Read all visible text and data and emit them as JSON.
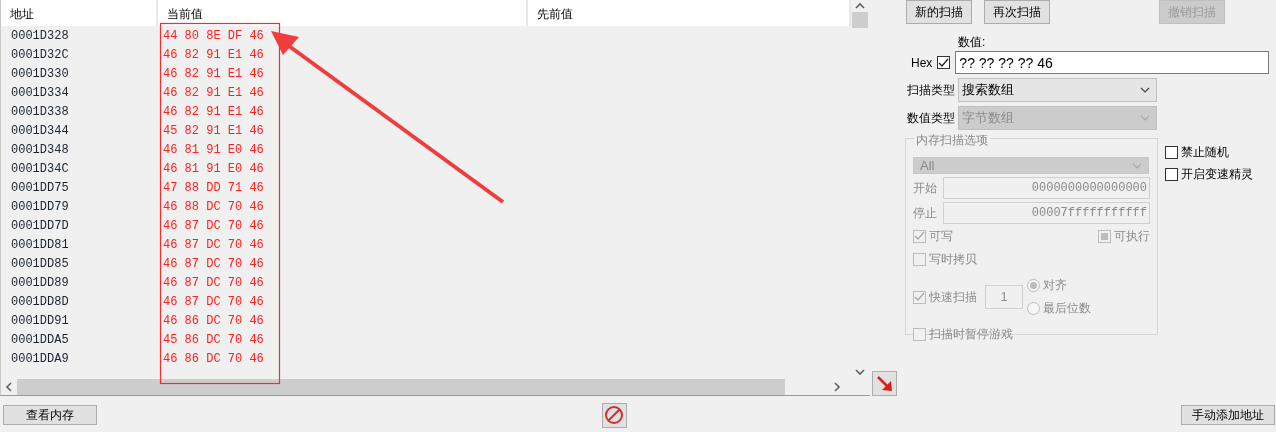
{
  "results": {
    "columns": [
      "地址",
      "当前值",
      "先前值"
    ],
    "rows": [
      {
        "address": "0001D328",
        "current": "44 80 8E DF 46"
      },
      {
        "address": "0001D32C",
        "current": "46 82 91 E1 46"
      },
      {
        "address": "0001D330",
        "current": "46 82 91 E1 46"
      },
      {
        "address": "0001D334",
        "current": "46 82 91 E1 46"
      },
      {
        "address": "0001D338",
        "current": "46 82 91 E1 46"
      },
      {
        "address": "0001D344",
        "current": "45 82 91 E1 46"
      },
      {
        "address": "0001D348",
        "current": "46 81 91 E0 46"
      },
      {
        "address": "0001D34C",
        "current": "46 81 91 E0 46"
      },
      {
        "address": "0001DD75",
        "current": "47 88 DD 71 46"
      },
      {
        "address": "0001DD79",
        "current": "46 88 DC 70 46"
      },
      {
        "address": "0001DD7D",
        "current": "46 87 DC 70 46"
      },
      {
        "address": "0001DD81",
        "current": "46 87 DC 70 46"
      },
      {
        "address": "0001DD85",
        "current": "46 87 DC 70 46"
      },
      {
        "address": "0001DD89",
        "current": "46 87 DC 70 46"
      },
      {
        "address": "0001DD8D",
        "current": "46 87 DC 70 46"
      },
      {
        "address": "0001DD91",
        "current": "46 86 DC 70 46"
      },
      {
        "address": "0001DDA5",
        "current": "45 86 DC 70 46"
      },
      {
        "address": "0001DDA9",
        "current": "46 86 DC 70 46"
      }
    ]
  },
  "scan": {
    "buttons": [
      {
        "label": "新的扫描",
        "disabled": false
      },
      {
        "label": "再次扫描",
        "disabled": false
      },
      {
        "label": "撤销扫描",
        "disabled": true
      }
    ],
    "value_label": "数值:",
    "hex": {
      "label": "Hex",
      "checked": true
    },
    "value": "?? ?? ?? ?? 46",
    "scan_type": {
      "label": "扫描类型",
      "value": "搜索数组",
      "disabled": false
    },
    "value_type": {
      "label": "数值类型",
      "value": "字节数组",
      "disabled": true
    },
    "memory_options": {
      "title": "内存扫描选项",
      "disabled": true,
      "region": "All",
      "start": {
        "label": "开始",
        "value": "0000000000000000"
      },
      "stop": {
        "label": "停止",
        "value": "00007fffffffffff"
      },
      "writable": {
        "label": "可写",
        "checked": true
      },
      "executable": {
        "label": "可执行",
        "partial": true
      },
      "copy_on_write": {
        "label": "写时拷贝",
        "checked": false
      },
      "fast_scan": {
        "label": "快速扫描",
        "checked": true,
        "value": "1"
      },
      "alignment": [
        {
          "label": "对齐",
          "selected": true
        },
        {
          "label": "最后位数",
          "selected": false
        }
      ],
      "pause_game": {
        "label": "扫描时暂停游戏",
        "checked": false
      }
    },
    "side_options": [
      {
        "label": "禁止随机",
        "checked": false
      },
      {
        "label": "开启变速精灵",
        "checked": false
      }
    ]
  },
  "footer": {
    "view_memory": "查看内存",
    "add_address": "手动添加地址"
  }
}
